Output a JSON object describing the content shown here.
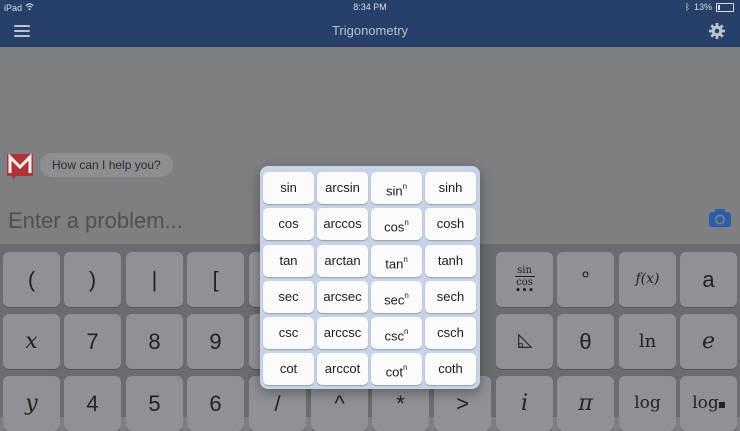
{
  "status_bar": {
    "device": "iPad",
    "time": "8:34 PM",
    "battery": "13%"
  },
  "header": {
    "title": "Trigonometry"
  },
  "chat": {
    "message": "How can I help you?"
  },
  "input": {
    "placeholder": "Enter a problem..."
  },
  "keyboard": {
    "row1": [
      "(",
      ")",
      "|",
      "[",
      "",
      "",
      "",
      "",
      "sin",
      "cos",
      "°",
      "f(x)",
      "a"
    ],
    "row2": [
      "x",
      "7",
      "8",
      "9",
      "",
      "",
      "",
      "",
      "",
      "θ",
      "ln",
      "e"
    ],
    "row3": [
      "y",
      "4",
      "5",
      "6",
      "/",
      "^",
      "*",
      ">",
      "i",
      "π",
      "log",
      "log"
    ]
  },
  "trig_panel": {
    "rows": [
      [
        "sin",
        "arcsin",
        "sin",
        "sinh"
      ],
      [
        "cos",
        "arccos",
        "cos",
        "cosh"
      ],
      [
        "tan",
        "arctan",
        "tan",
        "tanh"
      ],
      [
        "sec",
        "arcsec",
        "sec",
        "sech"
      ],
      [
        "csc",
        "arccsc",
        "csc",
        "csch"
      ],
      [
        "cot",
        "arccot",
        "cot",
        "coth"
      ]
    ],
    "power_sup": "n"
  },
  "colors": {
    "header_bg": "#26406a",
    "panel_bg": "#c7d3e6",
    "key_bg": "#8f9196"
  }
}
